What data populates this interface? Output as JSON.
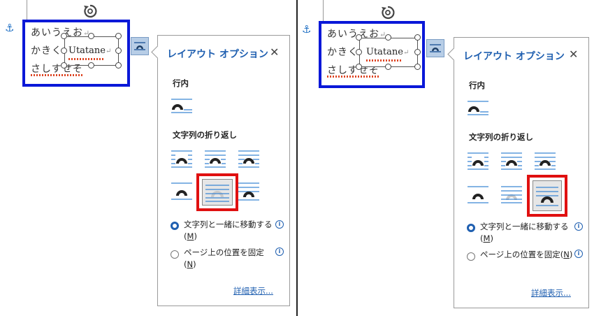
{
  "doc": {
    "line1": "あいうえお",
    "line2": "かきく",
    "line3": "さしすせそ",
    "para_mark": "↵",
    "textbox_text": "Utatane"
  },
  "panel": {
    "title": "レイアウト オプション",
    "close": "✕",
    "inline_section": "行内",
    "wrap_section": "文字列の折り返し",
    "option_move": "文字列と一緒に移動する(",
    "option_move_key": "M",
    "option_fixed": "ページ上の位置を固定(",
    "option_fixed_key": "N",
    "key_close": ")",
    "info": "i",
    "more_link": "詳細表示..."
  },
  "icons": {
    "anchor": "anchor-icon",
    "rotate": "rotate-handle-icon",
    "layout_button": "layout-options-icon"
  },
  "screens": [
    {
      "label": "left",
      "selected_wrap_option": "behind-text"
    },
    {
      "label": "right",
      "selected_wrap_option": "in-front-of-text"
    }
  ],
  "colors": {
    "frame_highlight": "#0a18d8",
    "selection_highlight": "#e01010",
    "accent": "#1f5fb0",
    "wrap_line": "#3b86d4",
    "shape": "#222222"
  }
}
